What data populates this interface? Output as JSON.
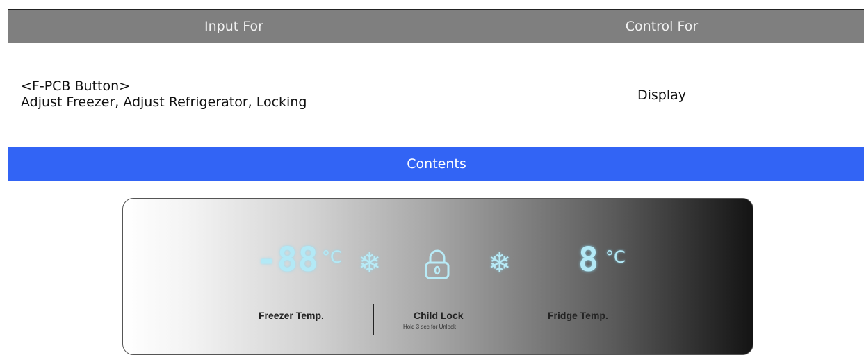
{
  "table": {
    "header_left": "Input For",
    "header_right": "Control For",
    "input_line1": "<F-PCB Button>",
    "input_line2": "Adjust Freezer, Adjust Refrigerator, Locking",
    "control": "Display",
    "contents_header": "Contents"
  },
  "panel": {
    "freezer_display": "-88",
    "freezer_unit": "°C",
    "fridge_display": "8",
    "fridge_unit": "°C",
    "freezer_label": "Freezer Temp.",
    "child_lock_label": "Child Lock",
    "child_lock_sub": "Hold 3 sec for Unlock",
    "fridge_label": "Fridge Temp.",
    "icons": [
      "snowflake-icon",
      "lock-icon",
      "snowflake-icon"
    ],
    "colors": {
      "header_gray": "#7f7f7f",
      "band_blue": "#3264f5",
      "led_cyan": "#b3e9f6"
    }
  }
}
